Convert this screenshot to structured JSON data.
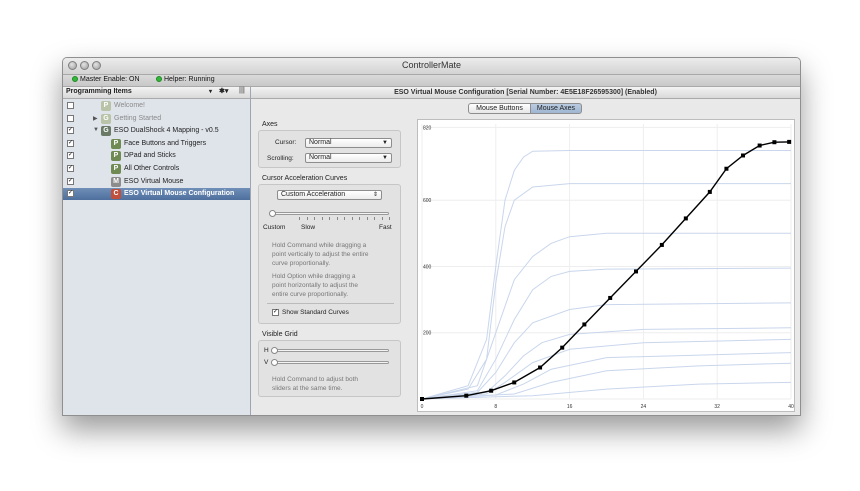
{
  "window": {
    "title": "ControllerMate"
  },
  "status": {
    "master": "Master Enable: ON",
    "helper": "Helper: Running",
    "dot_color": "#33b83a"
  },
  "sidebar": {
    "header": "Programming Items",
    "items": [
      {
        "label": "Welcome!",
        "badge": "P",
        "badge_color": "#b9c3a7",
        "checked": false,
        "dimmed": true
      },
      {
        "label": "Getting Started",
        "badge": "G",
        "badge_color": "#b9c3a7",
        "checked": false,
        "dimmed": true
      },
      {
        "label": "ESO DualShock 4 Mapping - v0.5",
        "badge": "G",
        "badge_color": "#6a7a66",
        "checked": true,
        "dimmed": false
      },
      {
        "label": "Face Buttons and Triggers",
        "badge": "P",
        "badge_color": "#6f8a52",
        "checked": true,
        "dimmed": false
      },
      {
        "label": "DPad and Sticks",
        "badge": "P",
        "badge_color": "#6f8a52",
        "checked": true,
        "dimmed": false
      },
      {
        "label": "All Other Controls",
        "badge": "P",
        "badge_color": "#6f8a52",
        "checked": true,
        "dimmed": false
      },
      {
        "label": "ESO Virtual Mouse",
        "badge": "M",
        "badge_color": "#8c8c8c",
        "checked": true,
        "dimmed": false
      },
      {
        "label": "ESO Virtual Mouse Configuration",
        "badge": "C",
        "badge_color": "#c0503c",
        "checked": true,
        "dimmed": false,
        "selected": true
      }
    ]
  },
  "main": {
    "header": "ESO Virtual Mouse Configuration  [Serial Number: 4E5E18F26595300]  (Enabled)",
    "tabs": [
      {
        "label": "Mouse Buttons",
        "active": false
      },
      {
        "label": "Mouse Axes",
        "active": true
      }
    ],
    "axes": {
      "title": "Axes",
      "cursor_label": "Cursor:",
      "cursor_value": "Normal",
      "scrolling_label": "Scrolling:",
      "scrolling_value": "Normal"
    },
    "curves": {
      "title": "Cursor Acceleration Curves",
      "preset_value": "Custom Acceleration",
      "slider_labels": [
        "Custom",
        "Slow",
        "Fast"
      ],
      "hint1": [
        "Hold Command while dragging a",
        "point vertically to adjust the entire",
        "curve proportionally."
      ],
      "hint2": [
        "Hold Option while dragging a",
        "point horizontally to adjust the",
        "entire curve proportionally."
      ],
      "show_standard_label": "Show Standard Curves",
      "show_standard_checked": true
    },
    "grid": {
      "title": "Visible Grid",
      "h_label": "H",
      "v_label": "V",
      "hint": [
        "Hold Command to adjust both",
        "sliders at the same time."
      ]
    }
  },
  "chart_data": {
    "type": "line",
    "xlim": [
      0,
      40
    ],
    "ylim": [
      0,
      830
    ],
    "x_ticks": [
      0,
      8,
      16,
      24,
      32,
      40
    ],
    "y_ticks": [
      0,
      200,
      400,
      600,
      820
    ],
    "grid": true,
    "main_color": "#000000",
    "standard_color": "#c9d6ec",
    "series": [
      {
        "x": [
          0,
          4.8,
          7.5,
          10,
          12.8,
          15.2,
          17.6,
          20.4,
          23.2,
          26,
          28.6,
          31.2,
          33,
          34.8,
          36.6,
          38.2,
          39.8
        ],
        "y": [
          0,
          10,
          25,
          50,
          95,
          155,
          225,
          305,
          385,
          465,
          545,
          625,
          695,
          735,
          765,
          775,
          776
        ]
      }
    ],
    "standard_curves": [
      [
        [
          0,
          0
        ],
        [
          5,
          40
        ],
        [
          7,
          180
        ],
        [
          8,
          400
        ],
        [
          9,
          600
        ],
        [
          10,
          690
        ],
        [
          11,
          730
        ],
        [
          12,
          748
        ],
        [
          16,
          750
        ],
        [
          24,
          750
        ],
        [
          40,
          750
        ]
      ],
      [
        [
          0,
          0
        ],
        [
          5,
          30
        ],
        [
          7,
          120
        ],
        [
          8,
          350
        ],
        [
          9,
          520
        ],
        [
          10,
          600
        ],
        [
          12,
          640
        ],
        [
          16,
          650
        ],
        [
          40,
          650
        ]
      ],
      [
        [
          0,
          0
        ],
        [
          6,
          40
        ],
        [
          8,
          200
        ],
        [
          10,
          360
        ],
        [
          12,
          430
        ],
        [
          14,
          470
        ],
        [
          16,
          490
        ],
        [
          20,
          500
        ],
        [
          40,
          500
        ]
      ],
      [
        [
          0,
          0
        ],
        [
          6,
          25
        ],
        [
          8,
          120
        ],
        [
          10,
          240
        ],
        [
          12,
          330
        ],
        [
          14,
          370
        ],
        [
          16,
          385
        ],
        [
          20,
          392
        ],
        [
          40,
          395
        ]
      ],
      [
        [
          0,
          0
        ],
        [
          6,
          20
        ],
        [
          8,
          80
        ],
        [
          10,
          170
        ],
        [
          12,
          230
        ],
        [
          16,
          270
        ],
        [
          20,
          285
        ],
        [
          40,
          290
        ]
      ],
      [
        [
          0,
          0
        ],
        [
          7,
          20
        ],
        [
          9,
          70
        ],
        [
          11,
          130
        ],
        [
          13,
          170
        ],
        [
          16,
          195
        ],
        [
          24,
          210
        ],
        [
          40,
          215
        ]
      ],
      [
        [
          0,
          0
        ],
        [
          7,
          15
        ],
        [
          9,
          50
        ],
        [
          12,
          110
        ],
        [
          16,
          150
        ],
        [
          24,
          170
        ],
        [
          40,
          180
        ]
      ],
      [
        [
          0,
          0
        ],
        [
          8,
          12
        ],
        [
          11,
          45
        ],
        [
          14,
          90
        ],
        [
          20,
          125
        ],
        [
          40,
          140
        ]
      ],
      [
        [
          0,
          0
        ],
        [
          10,
          15
        ],
        [
          14,
          50
        ],
        [
          20,
          85
        ],
        [
          30,
          100
        ],
        [
          40,
          108
        ]
      ],
      [
        [
          0,
          0
        ],
        [
          12,
          10
        ],
        [
          20,
          30
        ],
        [
          30,
          45
        ],
        [
          40,
          50
        ]
      ]
    ]
  }
}
